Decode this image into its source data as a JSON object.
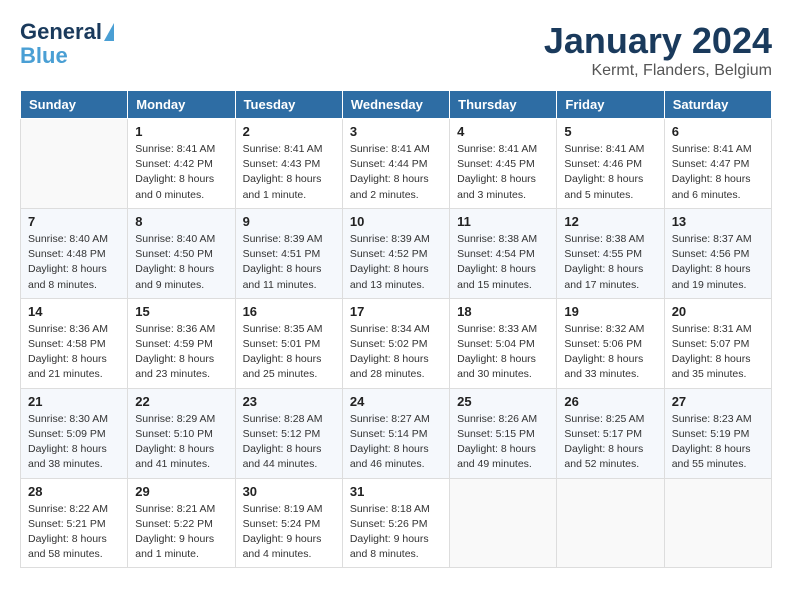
{
  "header": {
    "logo_line1": "General",
    "logo_line2": "Blue",
    "month": "January 2024",
    "location": "Kermt, Flanders, Belgium"
  },
  "days_of_week": [
    "Sunday",
    "Monday",
    "Tuesday",
    "Wednesday",
    "Thursday",
    "Friday",
    "Saturday"
  ],
  "weeks": [
    [
      {
        "day": "",
        "info": ""
      },
      {
        "day": "1",
        "info": "Sunrise: 8:41 AM\nSunset: 4:42 PM\nDaylight: 8 hours\nand 0 minutes."
      },
      {
        "day": "2",
        "info": "Sunrise: 8:41 AM\nSunset: 4:43 PM\nDaylight: 8 hours\nand 1 minute."
      },
      {
        "day": "3",
        "info": "Sunrise: 8:41 AM\nSunset: 4:44 PM\nDaylight: 8 hours\nand 2 minutes."
      },
      {
        "day": "4",
        "info": "Sunrise: 8:41 AM\nSunset: 4:45 PM\nDaylight: 8 hours\nand 3 minutes."
      },
      {
        "day": "5",
        "info": "Sunrise: 8:41 AM\nSunset: 4:46 PM\nDaylight: 8 hours\nand 5 minutes."
      },
      {
        "day": "6",
        "info": "Sunrise: 8:41 AM\nSunset: 4:47 PM\nDaylight: 8 hours\nand 6 minutes."
      }
    ],
    [
      {
        "day": "7",
        "info": "Sunrise: 8:40 AM\nSunset: 4:48 PM\nDaylight: 8 hours\nand 8 minutes."
      },
      {
        "day": "8",
        "info": "Sunrise: 8:40 AM\nSunset: 4:50 PM\nDaylight: 8 hours\nand 9 minutes."
      },
      {
        "day": "9",
        "info": "Sunrise: 8:39 AM\nSunset: 4:51 PM\nDaylight: 8 hours\nand 11 minutes."
      },
      {
        "day": "10",
        "info": "Sunrise: 8:39 AM\nSunset: 4:52 PM\nDaylight: 8 hours\nand 13 minutes."
      },
      {
        "day": "11",
        "info": "Sunrise: 8:38 AM\nSunset: 4:54 PM\nDaylight: 8 hours\nand 15 minutes."
      },
      {
        "day": "12",
        "info": "Sunrise: 8:38 AM\nSunset: 4:55 PM\nDaylight: 8 hours\nand 17 minutes."
      },
      {
        "day": "13",
        "info": "Sunrise: 8:37 AM\nSunset: 4:56 PM\nDaylight: 8 hours\nand 19 minutes."
      }
    ],
    [
      {
        "day": "14",
        "info": "Sunrise: 8:36 AM\nSunset: 4:58 PM\nDaylight: 8 hours\nand 21 minutes."
      },
      {
        "day": "15",
        "info": "Sunrise: 8:36 AM\nSunset: 4:59 PM\nDaylight: 8 hours\nand 23 minutes."
      },
      {
        "day": "16",
        "info": "Sunrise: 8:35 AM\nSunset: 5:01 PM\nDaylight: 8 hours\nand 25 minutes."
      },
      {
        "day": "17",
        "info": "Sunrise: 8:34 AM\nSunset: 5:02 PM\nDaylight: 8 hours\nand 28 minutes."
      },
      {
        "day": "18",
        "info": "Sunrise: 8:33 AM\nSunset: 5:04 PM\nDaylight: 8 hours\nand 30 minutes."
      },
      {
        "day": "19",
        "info": "Sunrise: 8:32 AM\nSunset: 5:06 PM\nDaylight: 8 hours\nand 33 minutes."
      },
      {
        "day": "20",
        "info": "Sunrise: 8:31 AM\nSunset: 5:07 PM\nDaylight: 8 hours\nand 35 minutes."
      }
    ],
    [
      {
        "day": "21",
        "info": "Sunrise: 8:30 AM\nSunset: 5:09 PM\nDaylight: 8 hours\nand 38 minutes."
      },
      {
        "day": "22",
        "info": "Sunrise: 8:29 AM\nSunset: 5:10 PM\nDaylight: 8 hours\nand 41 minutes."
      },
      {
        "day": "23",
        "info": "Sunrise: 8:28 AM\nSunset: 5:12 PM\nDaylight: 8 hours\nand 44 minutes."
      },
      {
        "day": "24",
        "info": "Sunrise: 8:27 AM\nSunset: 5:14 PM\nDaylight: 8 hours\nand 46 minutes."
      },
      {
        "day": "25",
        "info": "Sunrise: 8:26 AM\nSunset: 5:15 PM\nDaylight: 8 hours\nand 49 minutes."
      },
      {
        "day": "26",
        "info": "Sunrise: 8:25 AM\nSunset: 5:17 PM\nDaylight: 8 hours\nand 52 minutes."
      },
      {
        "day": "27",
        "info": "Sunrise: 8:23 AM\nSunset: 5:19 PM\nDaylight: 8 hours\nand 55 minutes."
      }
    ],
    [
      {
        "day": "28",
        "info": "Sunrise: 8:22 AM\nSunset: 5:21 PM\nDaylight: 8 hours\nand 58 minutes."
      },
      {
        "day": "29",
        "info": "Sunrise: 8:21 AM\nSunset: 5:22 PM\nDaylight: 9 hours\nand 1 minute."
      },
      {
        "day": "30",
        "info": "Sunrise: 8:19 AM\nSunset: 5:24 PM\nDaylight: 9 hours\nand 4 minutes."
      },
      {
        "day": "31",
        "info": "Sunrise: 8:18 AM\nSunset: 5:26 PM\nDaylight: 9 hours\nand 8 minutes."
      },
      {
        "day": "",
        "info": ""
      },
      {
        "day": "",
        "info": ""
      },
      {
        "day": "",
        "info": ""
      }
    ]
  ]
}
